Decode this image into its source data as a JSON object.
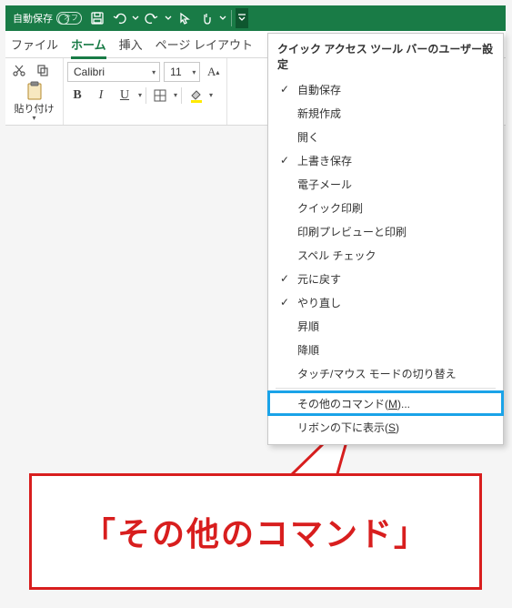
{
  "titlebar": {
    "autosave_label": "自動保存",
    "autosave_state": "オフ"
  },
  "tabs": {
    "file": "ファイル",
    "home": "ホーム",
    "insert": "挿入",
    "pagelayout": "ページ レイアウト"
  },
  "ribbon": {
    "paste_label": "貼り付け",
    "font_name": "Calibri",
    "font_size": "11"
  },
  "menu": {
    "title": "クイック アクセス ツール バーのユーザー設定",
    "items": [
      {
        "label": "自動保存",
        "checked": true
      },
      {
        "label": "新規作成",
        "checked": false
      },
      {
        "label": "開く",
        "checked": false
      },
      {
        "label": "上書き保存",
        "checked": true
      },
      {
        "label": "電子メール",
        "checked": false
      },
      {
        "label": "クイック印刷",
        "checked": false
      },
      {
        "label": "印刷プレビューと印刷",
        "checked": false
      },
      {
        "label": "スペル チェック",
        "checked": false
      },
      {
        "label": "元に戻す",
        "checked": true
      },
      {
        "label": "やり直し",
        "checked": true
      },
      {
        "label": "昇順",
        "checked": false
      },
      {
        "label": "降順",
        "checked": false
      },
      {
        "label": "タッチ/マウス モードの切り替え",
        "checked": false
      }
    ],
    "more_commands_pre": "その他のコマンド(",
    "more_commands_key": "M",
    "more_commands_post": ")...",
    "below_ribbon_pre": "リボンの下に表示(",
    "below_ribbon_key": "S",
    "below_ribbon_post": ")"
  },
  "callout": {
    "text": "「その他のコマンド」"
  }
}
